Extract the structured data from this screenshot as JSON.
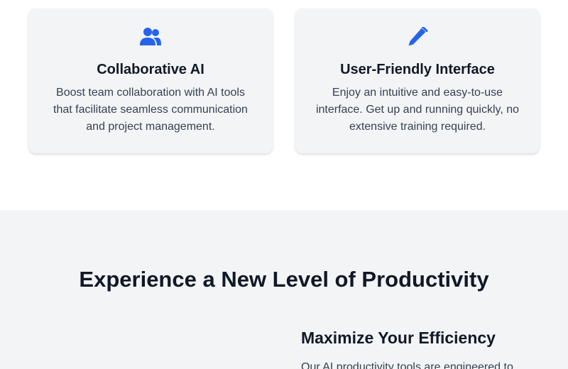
{
  "features": {
    "cards": [
      {
        "icon": "users-icon",
        "title": "Collaborative AI",
        "text": "Boost team collaboration with AI tools that facilitate seamless communication and project management."
      },
      {
        "icon": "pencil-icon",
        "title": "User-Friendly Interface",
        "text": "Enjoy an intuitive and easy-to-use interface. Get up and running quickly, no extensive training required."
      }
    ]
  },
  "productivity": {
    "heading": "Experience a New Level of Productivity",
    "subheading": "Maximize Your Efficiency",
    "description": "Our AI productivity tools are engineered to"
  },
  "colors": {
    "accent": "#2563eb",
    "section_bg": "#f3f4f6",
    "heading": "#111827",
    "body_text": "#374151"
  }
}
